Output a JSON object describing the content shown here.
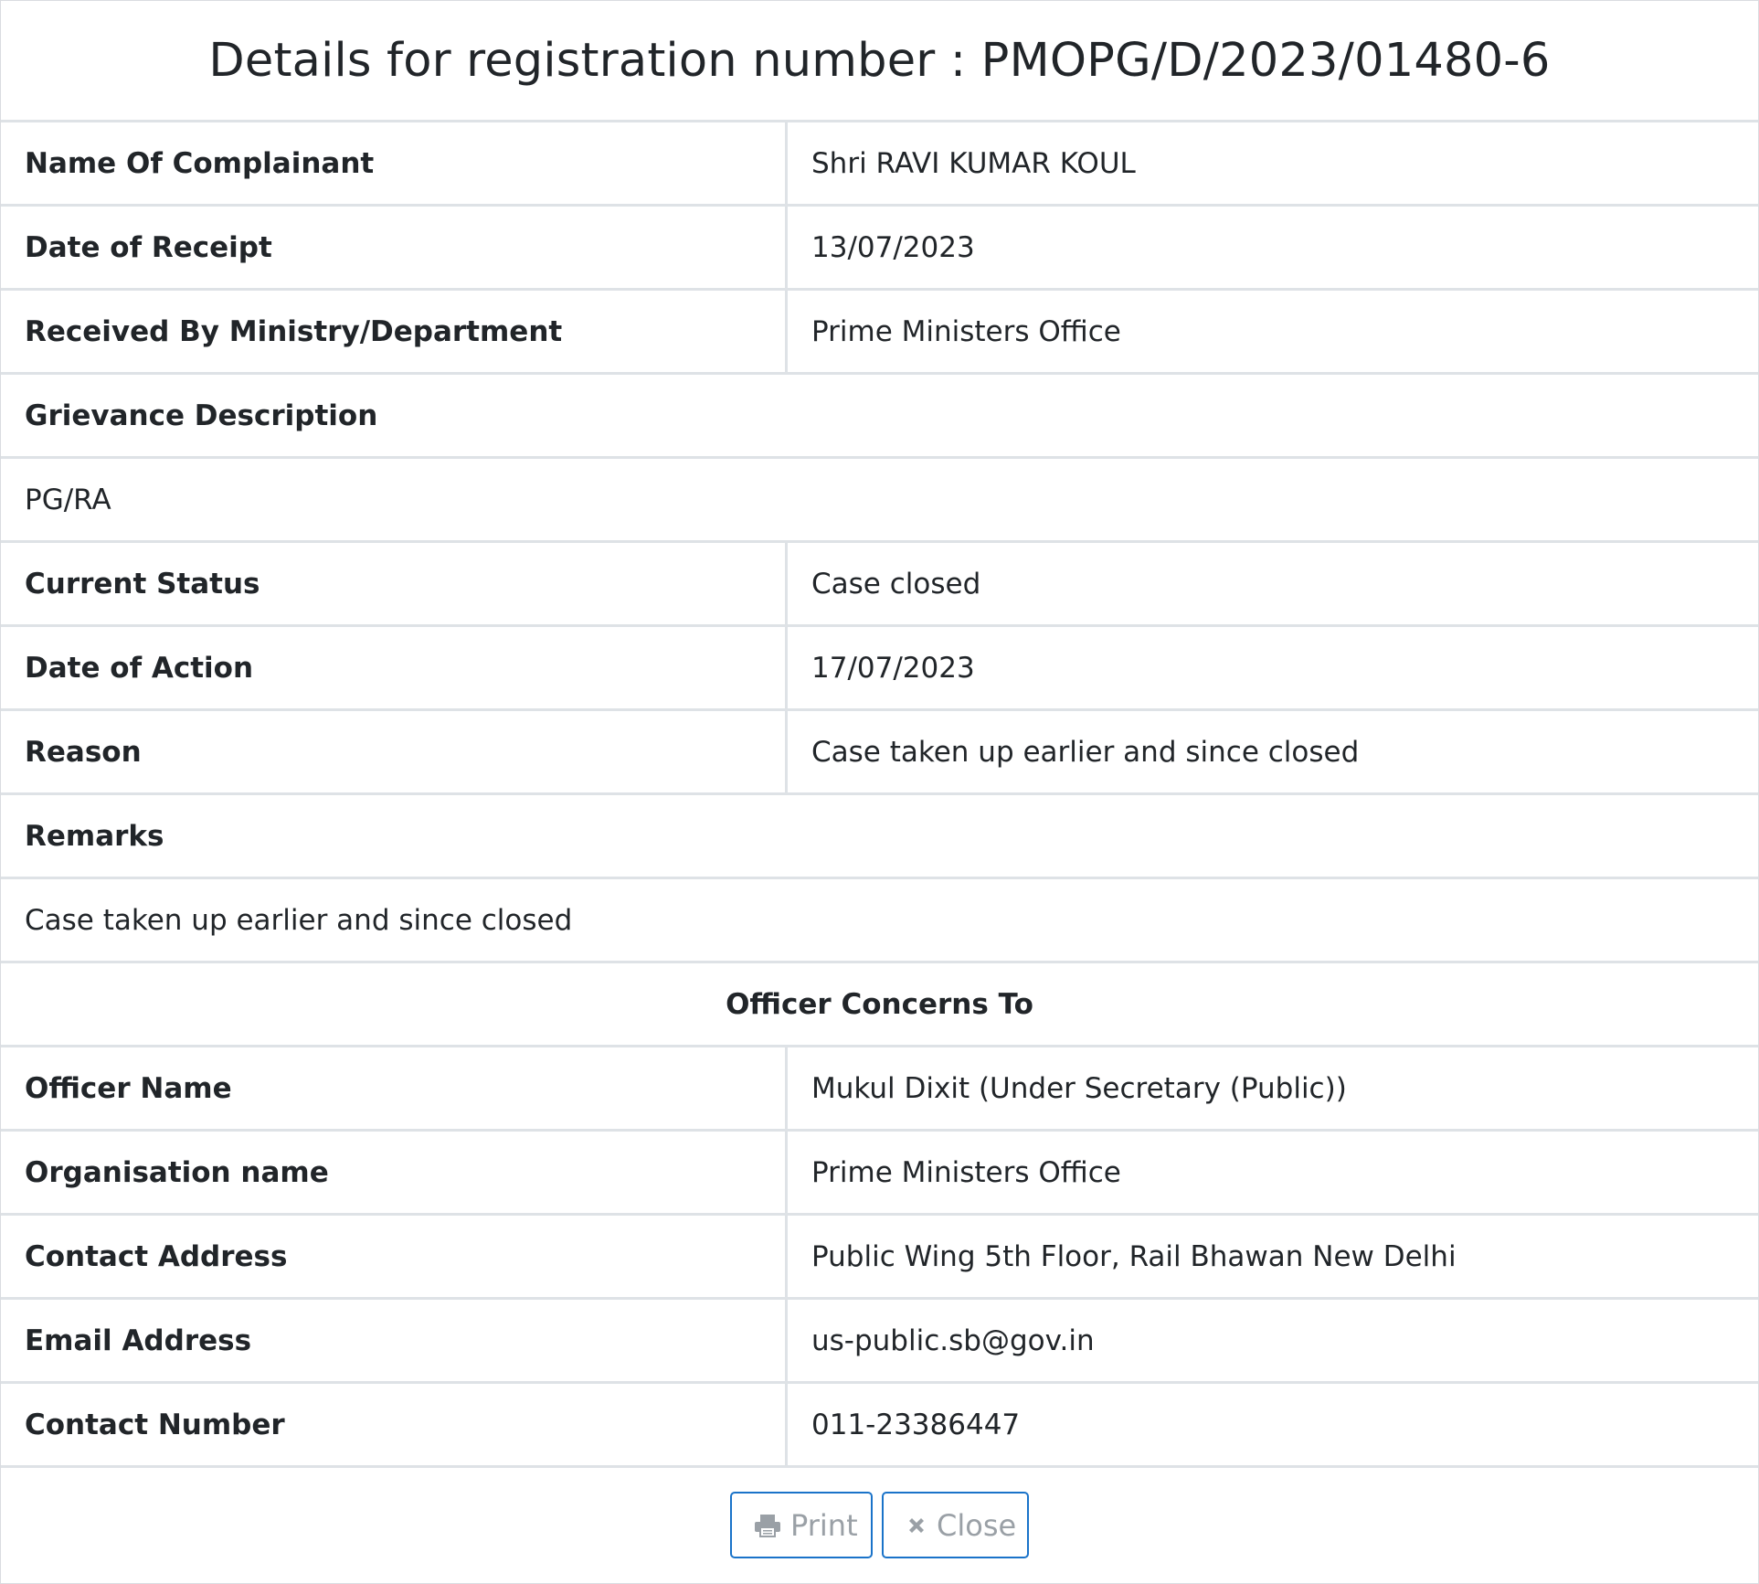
{
  "title": "Details for registration number : PMOPG/D/2023/01480-6",
  "fields": {
    "name_of_complainant": {
      "label": "Name Of Complainant",
      "value": "Shri RAVI KUMAR KOUL"
    },
    "date_of_receipt": {
      "label": "Date of Receipt",
      "value": "13/07/2023"
    },
    "received_by": {
      "label": "Received By Ministry/Department",
      "value": "Prime Ministers Office"
    },
    "grievance_description": {
      "label": "Grievance Description",
      "value": "PG/RA"
    },
    "current_status": {
      "label": "Current Status",
      "value": "Case closed"
    },
    "date_of_action": {
      "label": "Date of Action",
      "value": "17/07/2023"
    },
    "reason": {
      "label": "Reason",
      "value": "Case taken up earlier and since closed"
    },
    "remarks": {
      "label": "Remarks",
      "value": "Case taken up earlier and since closed"
    }
  },
  "officer_section": {
    "heading": "Officer Concerns To",
    "officer_name": {
      "label": "Officer Name",
      "value": "Mukul Dixit (Under Secretary (Public))"
    },
    "organisation_name": {
      "label": "Organisation name",
      "value": "Prime Ministers Office"
    },
    "contact_address": {
      "label": "Contact Address",
      "value": "Public Wing 5th Floor, Rail Bhawan New Delhi"
    },
    "email_address": {
      "label": "Email Address",
      "value": "us-public.sb@gov.in"
    },
    "contact_number": {
      "label": "Contact Number",
      "value": "011-23386447"
    }
  },
  "buttons": {
    "print_label": "Print",
    "close_label": "Close",
    "print_icon": "printer-icon",
    "close_icon": "close-icon"
  },
  "colors": {
    "button_border": "#1a73c9",
    "button_text": "#9aa0a6",
    "grid_line": "#dee2e6"
  }
}
